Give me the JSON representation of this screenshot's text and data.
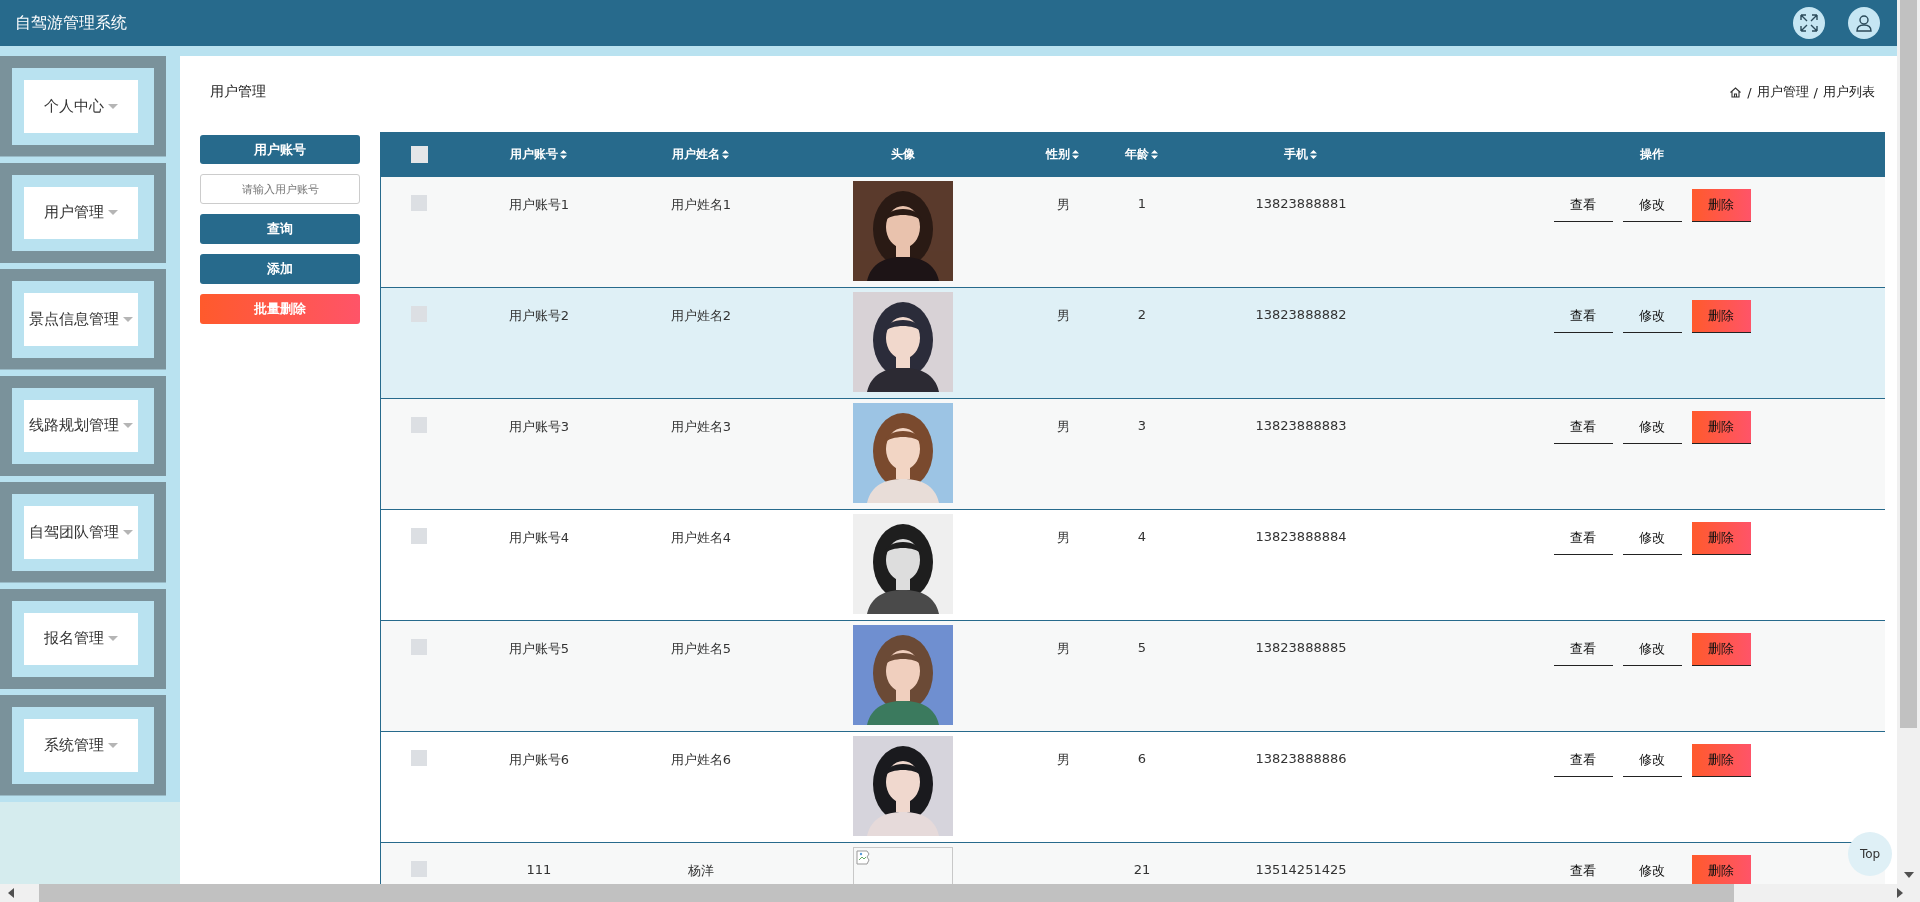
{
  "app": {
    "title": "自驾游管理系统"
  },
  "sidebar": {
    "items": [
      {
        "label": "个人中心"
      },
      {
        "label": "用户管理"
      },
      {
        "label": "景点信息管理"
      },
      {
        "label": "线路规划管理"
      },
      {
        "label": "自驾团队管理"
      },
      {
        "label": "报名管理"
      },
      {
        "label": "系统管理"
      }
    ]
  },
  "page": {
    "title": "用户管理",
    "breadcrumb": [
      {
        "separator": "/",
        "label": "用户管理"
      },
      {
        "separator": "/",
        "label": "用户列表"
      }
    ]
  },
  "filters": {
    "field_label": "用户账号",
    "search": {
      "placeholder": "请输入用户账号"
    },
    "buttons": [
      {
        "label": "查询",
        "kind": "primary"
      },
      {
        "label": "添加",
        "kind": "primary"
      },
      {
        "label": "批量删除",
        "kind": "danger"
      }
    ]
  },
  "table": {
    "columns": [
      {
        "kind": "checkbox",
        "checked": false
      },
      {
        "kind": "text",
        "label": "用户账号",
        "sortable": true
      },
      {
        "kind": "text",
        "label": "用户姓名",
        "sortable": true
      },
      {
        "kind": "text",
        "label": "头像",
        "sortable": false
      },
      {
        "kind": "text",
        "label": "性别",
        "sortable": true
      },
      {
        "kind": "text",
        "label": "年龄",
        "sortable": true
      },
      {
        "kind": "text",
        "label": "手机",
        "sortable": true
      },
      {
        "kind": "text",
        "label": "操作",
        "sortable": false
      }
    ],
    "rows": [
      {
        "checked": false,
        "highlighted": false,
        "account": "用户账号1",
        "name": "用户姓名1",
        "gender": "男",
        "age": "1",
        "phone": "13823888881",
        "actions": [
          {
            "label": "查看",
            "kind": "plain"
          },
          {
            "label": "修改",
            "kind": "plain"
          },
          {
            "label": "删除",
            "kind": "danger"
          }
        ]
      },
      {
        "checked": false,
        "highlighted": true,
        "account": "用户账号2",
        "name": "用户姓名2",
        "gender": "男",
        "age": "2",
        "phone": "13823888882",
        "actions": [
          {
            "label": "查看",
            "kind": "plain"
          },
          {
            "label": "修改",
            "kind": "plain"
          },
          {
            "label": "删除",
            "kind": "danger"
          }
        ]
      },
      {
        "checked": false,
        "highlighted": false,
        "account": "用户账号3",
        "name": "用户姓名3",
        "gender": "男",
        "age": "3",
        "phone": "13823888883",
        "actions": [
          {
            "label": "查看",
            "kind": "plain"
          },
          {
            "label": "修改",
            "kind": "plain"
          },
          {
            "label": "删除",
            "kind": "danger"
          }
        ]
      },
      {
        "checked": false,
        "highlighted": false,
        "account": "用户账号4",
        "name": "用户姓名4",
        "gender": "男",
        "age": "4",
        "phone": "13823888884",
        "actions": [
          {
            "label": "查看",
            "kind": "plain"
          },
          {
            "label": "修改",
            "kind": "plain"
          },
          {
            "label": "删除",
            "kind": "danger"
          }
        ]
      },
      {
        "checked": false,
        "highlighted": false,
        "account": "用户账号5",
        "name": "用户姓名5",
        "gender": "男",
        "age": "5",
        "phone": "13823888885",
        "actions": [
          {
            "label": "查看",
            "kind": "plain"
          },
          {
            "label": "修改",
            "kind": "plain"
          },
          {
            "label": "删除",
            "kind": "danger"
          }
        ]
      },
      {
        "checked": false,
        "highlighted": false,
        "account": "用户账号6",
        "name": "用户姓名6",
        "gender": "男",
        "age": "6",
        "phone": "13823888886",
        "actions": [
          {
            "label": "查看",
            "kind": "plain"
          },
          {
            "label": "修改",
            "kind": "plain"
          },
          {
            "label": "删除",
            "kind": "danger"
          }
        ]
      },
      {
        "checked": false,
        "highlighted": false,
        "account": "111",
        "name": "杨洋",
        "avatar": {
          "kind": "broken"
        },
        "age": "21",
        "phone": "13514251425",
        "actions": [
          {
            "label": "查看",
            "kind": "plain"
          },
          {
            "label": "修改",
            "kind": "plain"
          },
          {
            "label": "删除",
            "kind": "danger"
          }
        ]
      }
    ]
  },
  "top_button": {
    "label": "Top"
  }
}
